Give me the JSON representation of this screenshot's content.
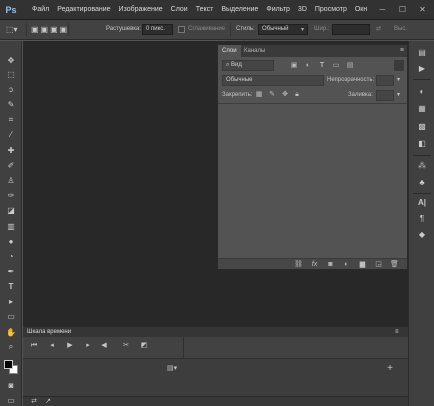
{
  "app": {
    "logo": "Ps"
  },
  "menu": [
    "Файл",
    "Редактирование",
    "Изображение",
    "Слои",
    "Текст",
    "Выделение",
    "Фильтр",
    "3D",
    "Просмотр",
    "Окн"
  ],
  "window_controls": {
    "minimize": "─",
    "maximize": "☐",
    "close": "✕"
  },
  "options": {
    "feather_label": "Растушевка:",
    "feather_value": "0 пикс.",
    "antialias_label": "Сглаживание",
    "style_label": "Стиль:",
    "style_value": "Обычный",
    "width_label": "Шир.:",
    "height_label": "Выс."
  },
  "tools": [
    "move-tool",
    "marquee-tool",
    "lasso-tool",
    "quick-selection-tool",
    "crop-tool",
    "eyedropper-tool",
    "healing-brush-tool",
    "brush-tool",
    "clone-stamp-tool",
    "history-brush-tool",
    "eraser-tool",
    "gradient-tool",
    "blur-tool",
    "dodge-tool",
    "pen-tool",
    "type-tool",
    "path-selection-tool",
    "rectangle-tool",
    "hand-tool",
    "zoom-tool"
  ],
  "layers_panel": {
    "tabs": [
      "Слои",
      "Каналы"
    ],
    "filter_label": "Вид",
    "blend_mode": "Обычные",
    "opacity_label": "Непрозрачность:",
    "lock_label": "Закрепить:",
    "fill_label": "Заливка:"
  },
  "timeline": {
    "title": "Шкала времени"
  }
}
